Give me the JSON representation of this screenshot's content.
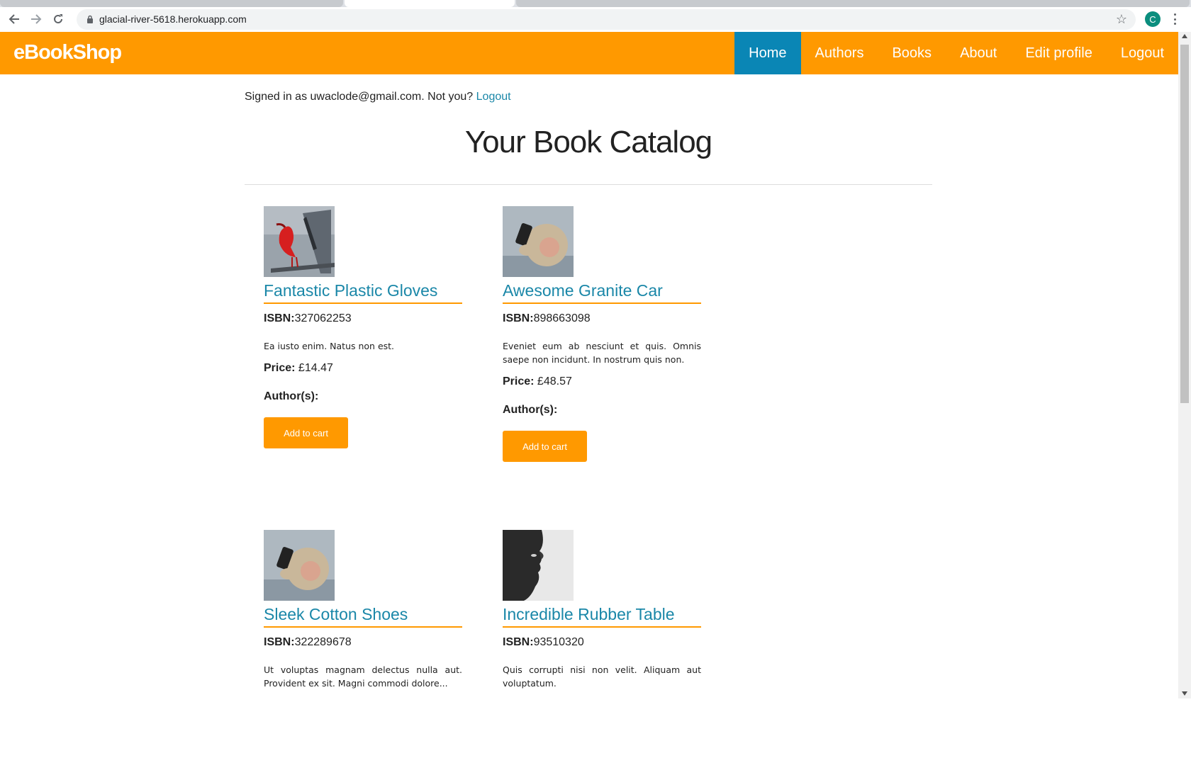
{
  "browser": {
    "url": "glacial-river-5618.herokuapp.com",
    "profile_initial": "C"
  },
  "navbar": {
    "brand": "eBookShop",
    "links": [
      {
        "label": "Home",
        "active": true
      },
      {
        "label": "Authors"
      },
      {
        "label": "Books"
      },
      {
        "label": "About"
      },
      {
        "label": "Edit profile"
      },
      {
        "label": "Logout"
      }
    ]
  },
  "session": {
    "prefix": "Signed in as uwaclode@gmail.com. Not you?",
    "logout_label": "Logout"
  },
  "page": {
    "title": "Your Book Catalog"
  },
  "books": [
    {
      "title": "Fantastic Plastic Gloves",
      "isbn_label": "ISBN:",
      "isbn": "327062253",
      "description": "Ea iusto enim. Natus non est.",
      "price_label": "Price:",
      "price": "£14.47",
      "authors_label": "Author(s):",
      "button": "Add to cart",
      "image": "red-bird-image"
    },
    {
      "title": "Awesome Granite Car",
      "isbn_label": "ISBN:",
      "isbn": "898663098",
      "description": "Eveniet eum ab nesciunt et quis. Omnis saepe non incidunt. In nostrum quis non.",
      "price_label": "Price:",
      "price": "£48.57",
      "authors_label": "Author(s):",
      "button": "Add to cart",
      "image": "monkey-phone-image"
    },
    {
      "title": "Sleek Cotton Shoes",
      "isbn_label": "ISBN:",
      "isbn": "322289678",
      "description": "Ut voluptas magnam delectus nulla aut. Provident ex sit. Magni commodi dolore...",
      "image": "monkey-phone-image"
    },
    {
      "title": "Incredible Rubber Table",
      "isbn_label": "ISBN:",
      "isbn": "93510320",
      "description": "Quis corrupti nisi non velit. Aliquam aut voluptatum.",
      "image": "face-profile-image"
    }
  ],
  "colors": {
    "brand_orange": "#ff9900",
    "active_nav": "#0a86b5",
    "link": "#1a87a8"
  }
}
